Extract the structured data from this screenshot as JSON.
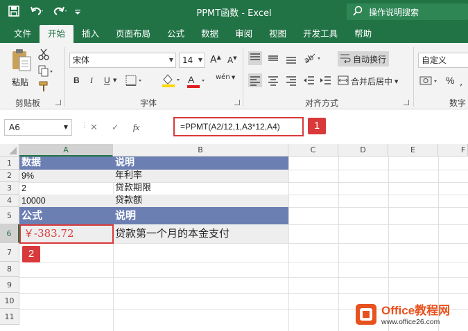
{
  "window": {
    "title": "PPMT函数 - Excel",
    "tell_me": "操作说明搜索"
  },
  "tabs": [
    "文件",
    "开始",
    "插入",
    "页面布局",
    "公式",
    "数据",
    "审阅",
    "视图",
    "开发工具",
    "帮助"
  ],
  "ribbon": {
    "paste_label": "粘贴",
    "clipboard_group": "剪贴板",
    "font_name": "宋体",
    "font_size": "14",
    "font_group": "字体",
    "wrap_text": "自动换行",
    "merge_center": "合并后居中",
    "align_group": "对齐方式",
    "number_format": "自定义",
    "number_group": "数字",
    "bold": "B",
    "italic": "I",
    "underline": "U",
    "grow_font": "A",
    "shrink_font": "A",
    "font_color_letter": "A",
    "phonetic": "wén",
    "percent": "%"
  },
  "formula_bar": {
    "name_box": "A6",
    "fx": "fx",
    "formula": "=PPMT(A2/12,1,A3*12,A4)"
  },
  "badges": {
    "one": "1",
    "two": "2"
  },
  "columns": [
    "A",
    "B",
    "C",
    "D",
    "E",
    "F"
  ],
  "rows": [
    "1",
    "2",
    "3",
    "4",
    "5",
    "6",
    "7",
    "8",
    "9",
    "10",
    "11"
  ],
  "cells": {
    "A1": "数据",
    "B1": "说明",
    "A2": "9%",
    "B2": "年利率",
    "A3": "2",
    "B3": "贷款期限",
    "A4": "10000",
    "B4": "贷款额",
    "A5": "公式",
    "B5": "说明",
    "A6": "￥-383.72",
    "B6": "贷款第一个月的本金支付"
  },
  "watermark": {
    "brand": "Office教程网",
    "url": "www.office26.com"
  },
  "colors": {
    "excel_green": "#217346",
    "header_fill": "#6b7fb3",
    "highlight_red": "#d9393a",
    "value_red": "#d9393a"
  }
}
